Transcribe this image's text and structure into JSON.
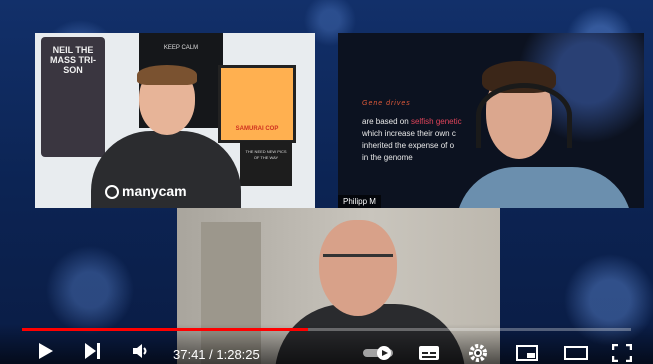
{
  "window_title": "",
  "videos": {
    "top_left": {
      "shirt_text": "NEIL THE MASS TRI-SON",
      "shirt2_text": "KEEP CALM",
      "poster_text": "SAMURAI COP",
      "sign_text": "THE NEED NEW PICS OF THE WAY",
      "logo_text": "manycam"
    },
    "top_right": {
      "slide_title": "Gene drives",
      "slide_line1_pre": "are based on ",
      "slide_line1_hl": "selfish genetic",
      "slide_line2": "which increase their own c",
      "slide_line3": "inherited the expense of o",
      "slide_line4": "in the genome",
      "name_tag": "Philipp M"
    },
    "bottom": {}
  },
  "player": {
    "progress": 0.47,
    "time_label": "37:41 / 1:28:25",
    "accent_color": "#ff0000",
    "icons": [
      "play-icon",
      "next-icon",
      "volume-icon",
      "autoplay-toggle",
      "subtitles-icon",
      "settings-icon",
      "miniplayer-icon",
      "theater-icon",
      "fullscreen-icon"
    ]
  }
}
